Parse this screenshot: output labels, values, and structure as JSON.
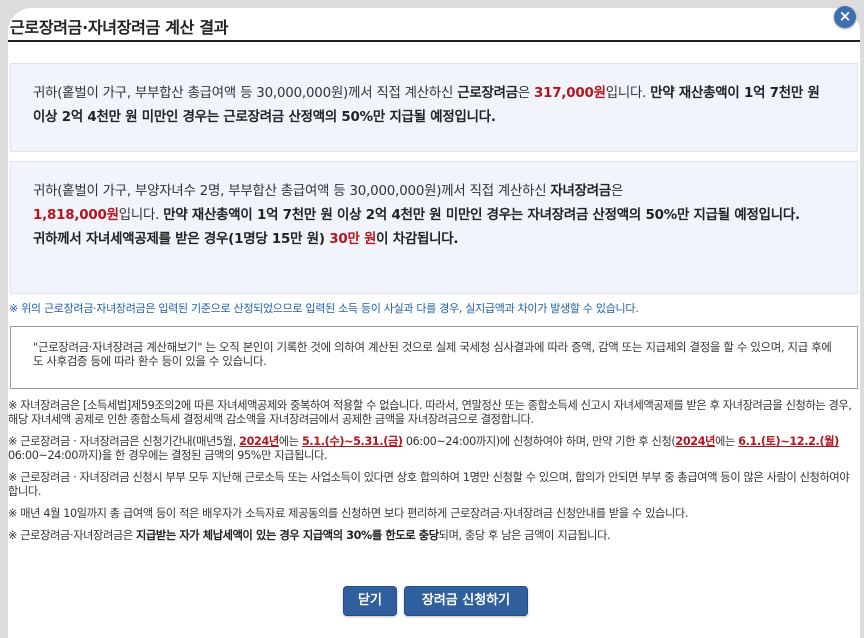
{
  "dialog": {
    "title": "근로장려금·자녀장려금 계산 결과",
    "close_icon": "×"
  },
  "result1": {
    "intro": "귀하(홑벌이 가구, 부부합산 총급여액 등 30,000,000원)께서 직접 계산하신 ",
    "term": "근로장려금",
    "mid": "은 ",
    "amount": "317,000원",
    "after": "입니다. ",
    "warning": "만약 재산총액이 1억 7천만 원 이상 2억 4천만 원 미만인 경우는 근로장려금 산정액의 50%만 지급될 예정입니다."
  },
  "result2": {
    "intro": "귀하(홑벌이 가구, 부양자녀수 2명, 부부합산 총급여액 등 30,000,000원)께서 직접 계산하신 ",
    "term": "자녀장려금",
    "mid": "은",
    "amount": "1,818,000원",
    "after": "입니다. ",
    "warning": "만약 재산총액이 1억 7천만 원 이상 2억 4천만 원 미만인 경우는 자녀장려금 산정액의 50%만 지급될 예정입니다.",
    "deduction_pre": "귀하께서 자녀세액공제를 받은 경우(1명당 15만 원) ",
    "deduction_amount": "30만 원",
    "deduction_post": "이 차감됩니다."
  },
  "top_note": "※ 위의 근로장려금·자녀장려금은 입력된 기준으로 산정되었으므로 입력된 소득 등이 사실과 다를 경우, 실지급액과 차이가 발생할 수 있습니다.",
  "disclaimer": "\"근로장려금·자녀장려금 계산해보기\" 는 오직 본인이 기록한 것에 의하여 계산된 것으로 실제 국세청 심사결과에 따라 증액, 감액 또는 지급제외 결정을 할 수 있으며, 지급 후에도 사후검증 등에 따라 환수 등이 있을 수 있습니다.",
  "notes": {
    "n1": "※ 자녀장려금은 [소득세법]제59조의2에 따른 자녀세액공제와 중복하여 적용할 수 없습니다. 따라서, 연말정산 또는 종합소득세 신고시 자녀세액공제를 받은 후 자녀장려금을 신청하는 경우, 해당 자녀세액 공제로 인한 종합소득세 결정세액 감소액을 자녀장려금에서 공제한 금액을 자녀장려금으로 결정합니다.",
    "n2_a": "※ 근로장려금 · 자녀장려금은 신청기간내(매년5월, ",
    "n2_year1": "2024년",
    "n2_b": "에는 ",
    "n2_period1": "5.1.(수)~5.31.(금)",
    "n2_c": " 06:00~24:00까지)에 신청하여야 하며, 만약 기한 후 신청(",
    "n2_year2": "2024년",
    "n2_d": "에는 ",
    "n2_period2": "6.1.(토)~12.2.(월)",
    "n2_e": " 06:00~24:00까지)을 한 경우에는 결정된 금액의 95%만 지급됩니다.",
    "n3": "※ 근로장려금 · 자녀장려금 신청시 부부 모두 지난해 근로소득 또는 사업소득이 있다면 상호 합의하여 1명만 신청할 수 있으며, 합의가 안되면 부부 중 총급여액 등이 많은 사람이 신청하여야 합니다.",
    "n4": "※ 매년 4월 10일까지 총 급여액 등이 적은 배우자가 소득자료 제공동의를 신청하면 보다 편리하게 근로장려금·자녀장려금 신청안내를 받을 수 있습니다.",
    "n5_a": "※ 근로장려금·자녀장려금은 ",
    "n5_bold": "지급받는 자가 체납세액이 있는 경우 지급액의 30%를 한도로 충당",
    "n5_b": "되며, 충당 후 남은 금액이 지급됩니다."
  },
  "buttons": {
    "close_label": "닫기",
    "apply_label": "장려금 신청하기"
  },
  "colors": {
    "accent": "#2f5f9d",
    "highlight_red": "#b8131d",
    "note_blue": "#1f5ea8",
    "box_bg": "#f1f5fb"
  }
}
